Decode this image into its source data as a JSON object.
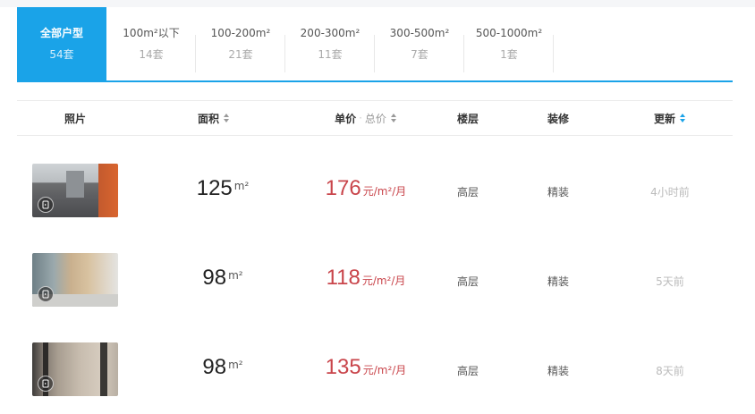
{
  "tabs": [
    {
      "label": "全部户型",
      "count": "54套",
      "active": true
    },
    {
      "label": "100m²以下",
      "count": "14套"
    },
    {
      "label": "100-200m²",
      "count": "21套"
    },
    {
      "label": "200-300m²",
      "count": "11套"
    },
    {
      "label": "300-500m²",
      "count": "7套"
    },
    {
      "label": "500-1000m²",
      "count": "1套"
    }
  ],
  "table": {
    "headers": {
      "photo": "照片",
      "area": "面积",
      "unit_price": "单价",
      "dot": "·",
      "total_price": "总价",
      "floor": "楼层",
      "decoration": "装修",
      "updated": "更新"
    },
    "rows": [
      {
        "area": "125",
        "area_unit": "m²",
        "price": "176",
        "price_unit": "元/m²/月",
        "floor": "高层",
        "decoration": "精装",
        "updated": "4小时前"
      },
      {
        "area": "98",
        "area_unit": "m²",
        "price": "118",
        "price_unit": "元/m²/月",
        "floor": "高层",
        "decoration": "精装",
        "updated": "5天前"
      },
      {
        "area": "98",
        "area_unit": "m²",
        "price": "135",
        "price_unit": "元/m²/月",
        "floor": "高层",
        "decoration": "精装",
        "updated": "8天前"
      }
    ]
  },
  "colors": {
    "accent": "#1aa3e8",
    "price": "#c9454b"
  },
  "icons": {
    "sort": "sort-arrows-icon",
    "vr": "vr-view-icon"
  }
}
